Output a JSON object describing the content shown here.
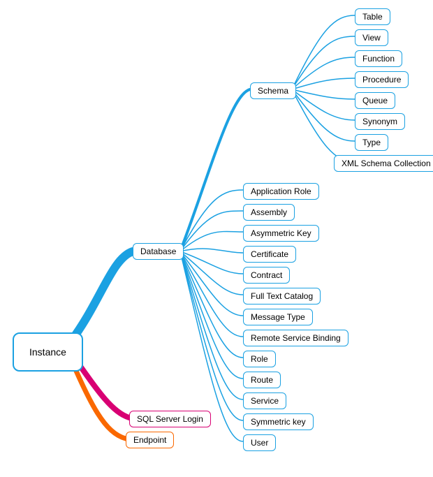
{
  "root": {
    "label": "Instance"
  },
  "level1": {
    "database": {
      "label": "Database"
    },
    "sql_login": {
      "label": "SQL Server Login"
    },
    "endpoint": {
      "label": "Endpoint"
    }
  },
  "schema": {
    "label": "Schema"
  },
  "schema_children": [
    {
      "label": "Table"
    },
    {
      "label": "View"
    },
    {
      "label": "Function"
    },
    {
      "label": "Procedure"
    },
    {
      "label": "Queue"
    },
    {
      "label": "Synonym"
    },
    {
      "label": "Type"
    },
    {
      "label": "XML Schema Collection"
    }
  ],
  "database_children": [
    {
      "label": "Application Role"
    },
    {
      "label": "Assembly"
    },
    {
      "label": "Asymmetric Key"
    },
    {
      "label": "Certificate"
    },
    {
      "label": "Contract"
    },
    {
      "label": "Full Text Catalog"
    },
    {
      "label": "Message Type"
    },
    {
      "label": "Remote Service Binding"
    },
    {
      "label": "Role"
    },
    {
      "label": "Route"
    },
    {
      "label": "Service"
    },
    {
      "label": "Symmetric key"
    },
    {
      "label": "User"
    }
  ]
}
